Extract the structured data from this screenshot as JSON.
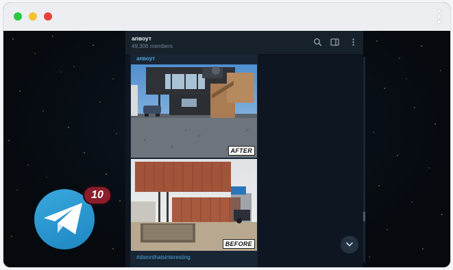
{
  "window": {
    "traffic_lights": [
      "close",
      "minimize",
      "zoom"
    ],
    "menu_icon": "vertical-ellipsis-icon"
  },
  "chat": {
    "name": "апвоут",
    "members": "49,306 members",
    "icons": [
      "search-icon",
      "side-panel-icon",
      "more-icon"
    ]
  },
  "message": {
    "sender": "апвоут",
    "photos": [
      {
        "label": "AFTER"
      },
      {
        "label": "BEFORE"
      }
    ],
    "hashtag": "#damnthatsinteresting"
  },
  "overlay": {
    "app_logo": "telegram-plane-icon",
    "notification_count": "10"
  },
  "colors": {
    "accent": "#4ea3d8",
    "badge": "#8b1e2c",
    "telegram_blue": "#2a9bd5"
  }
}
